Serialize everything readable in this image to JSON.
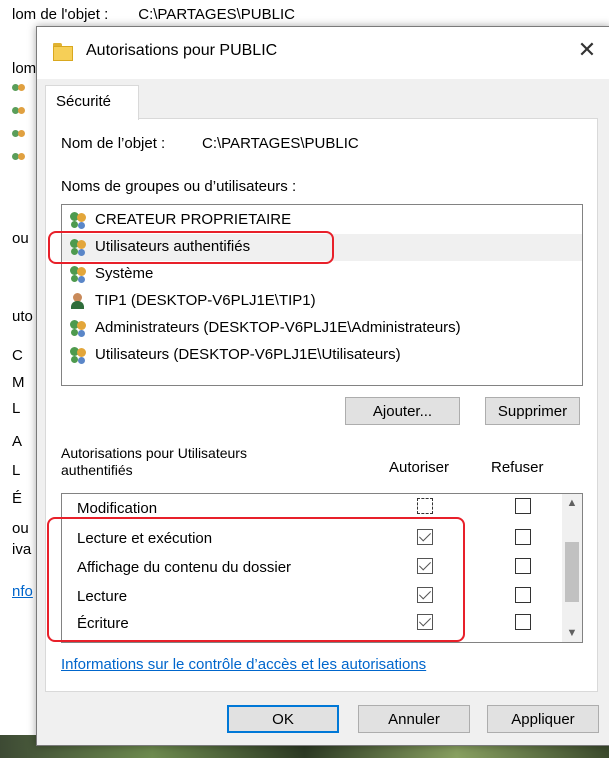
{
  "background_window": {
    "title_label": "lom de l'objet :",
    "title_value": "C:\\PARTAGES\\PUBLIC",
    "left_fragments": [
      "lom",
      "ou",
      "uto",
      "C",
      "M",
      "L",
      "A",
      "L",
      "É",
      "ou",
      "iva",
      "nfo"
    ]
  },
  "dialog": {
    "title": "Autorisations pour PUBLIC",
    "close_glyph": "✕",
    "tab_label": "Sécurité",
    "object_label": "Nom de l’objet :",
    "object_value": "C:\\PARTAGES\\PUBLIC",
    "groups_label": "Noms de groupes ou d’utilisateurs :",
    "groups": [
      {
        "name": "CREATEUR PROPRIETAIRE",
        "icon": "group-icon",
        "selected": false
      },
      {
        "name": "Utilisateurs authentifiés",
        "icon": "group-icon",
        "selected": true
      },
      {
        "name": "Système",
        "icon": "group-icon",
        "selected": false
      },
      {
        "name": "TIP1 (DESKTOP-V6PLJ1E\\TIP1)",
        "icon": "user-icon",
        "selected": false
      },
      {
        "name": "Administrateurs (DESKTOP-V6PLJ1E\\Administrateurs)",
        "icon": "group-icon",
        "selected": false
      },
      {
        "name": "Utilisateurs (DESKTOP-V6PLJ1E\\Utilisateurs)",
        "icon": "group-icon",
        "selected": false
      }
    ],
    "add_button": "Ajouter...",
    "remove_button": "Supprimer",
    "permissions_label_line1": "Autorisations pour Utilisateurs",
    "permissions_label_line2": "authentifiés",
    "allow_header": "Autoriser",
    "deny_header": "Refuser",
    "permissions": [
      {
        "name": "Modification",
        "allow": false,
        "deny": false
      },
      {
        "name": "Lecture et exécution",
        "allow": true,
        "deny": false
      },
      {
        "name": "Affichage du contenu du dossier",
        "allow": true,
        "deny": false
      },
      {
        "name": "Lecture",
        "allow": true,
        "deny": false
      },
      {
        "name": "Écriture",
        "allow": true,
        "deny": false
      }
    ],
    "info_link": "Informations sur le contrôle d’accès et les autorisations",
    "ok_button": "OK",
    "cancel_button": "Annuler",
    "apply_button": "Appliquer"
  },
  "colors": {
    "highlight": "#e8202a",
    "link": "#0066cc",
    "default_button_border": "#0078d7"
  }
}
